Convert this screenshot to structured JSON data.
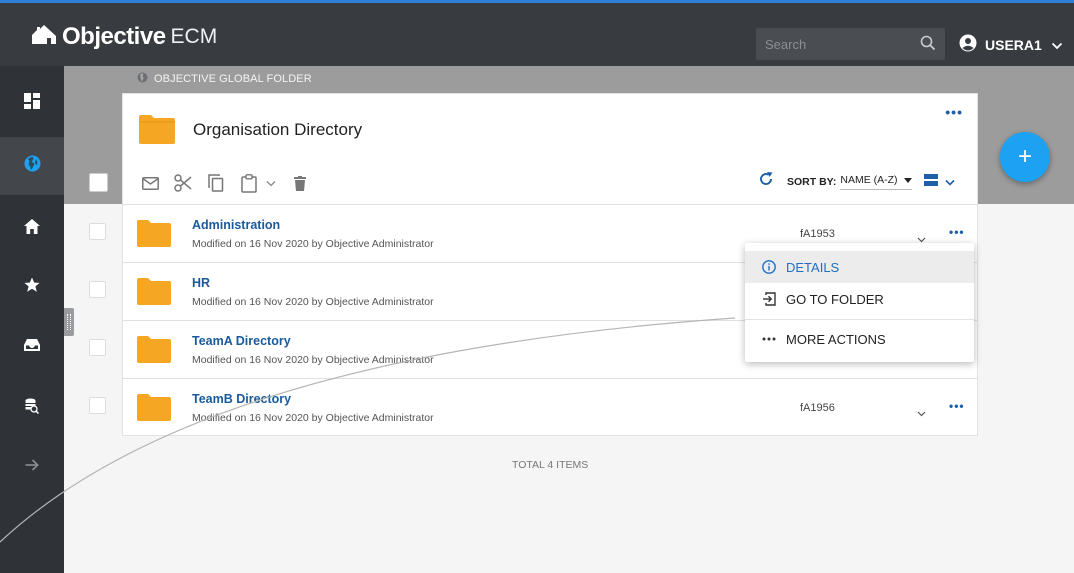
{
  "app": {
    "brand_main": "Objective",
    "brand_sub": "ECM",
    "accent": "#2d7fd3",
    "link_color": "#1a5a9c",
    "folder_color": "#f5a623",
    "fab_color": "#1da1f2"
  },
  "search": {
    "placeholder": "Search",
    "value": "",
    "icon": "search-icon"
  },
  "user": {
    "name": "USERA1",
    "icon": "account-circle-icon"
  },
  "sidebar": {
    "items": [
      {
        "icon": "dashboard-icon",
        "active": false
      },
      {
        "icon": "globe-icon",
        "active": true
      },
      {
        "icon": "home-icon",
        "active": false
      },
      {
        "icon": "star-icon",
        "active": false
      },
      {
        "icon": "inbox-icon",
        "active": false
      },
      {
        "icon": "database-search-icon",
        "active": false
      },
      {
        "icon": "arrow-right-icon",
        "active": false
      }
    ]
  },
  "breadcrumb": {
    "label": "OBJECTIVE GLOBAL FOLDER",
    "icon": "globe-icon"
  },
  "folder": {
    "title": "Organisation Directory",
    "more": "•••"
  },
  "toolbar": {
    "icons": [
      "email-icon",
      "cut-icon",
      "copy-icon",
      "paste-icon",
      "chevron-down-icon",
      "delete-icon"
    ],
    "refresh_icon": "refresh-icon",
    "sort_label": "SORT BY:",
    "sort_value": "NAME (A-Z)",
    "view_icon": "list-view-icon"
  },
  "rows": [
    {
      "name": "Administration",
      "meta": "Modified on 16 Nov 2020 by Objective Administrator",
      "code": "fA1953",
      "more": "•••"
    },
    {
      "name": "HR",
      "meta": "Modified on 16 Nov 2020 by Objective Administrator",
      "code": "",
      "more": ""
    },
    {
      "name": "TeamA Directory",
      "meta": "Modified on 16 Nov 2020 by Objective Administrator",
      "code": "",
      "more": ""
    },
    {
      "name": "TeamB Directory",
      "meta": "Modified on 16 Nov 2020 by Objective Administrator",
      "code": "fA1956",
      "more": "•••"
    }
  ],
  "total": "TOTAL 4 ITEMS",
  "fab": {
    "label": "+"
  },
  "menu": {
    "items": [
      {
        "label": "DETAILS",
        "icon": "info-icon",
        "selected": true
      },
      {
        "label": "GO TO FOLDER",
        "icon": "go-to-folder-icon",
        "selected": false
      },
      {
        "label": "MORE ACTIONS",
        "icon": "more-horizontal-icon",
        "selected": false
      }
    ]
  }
}
